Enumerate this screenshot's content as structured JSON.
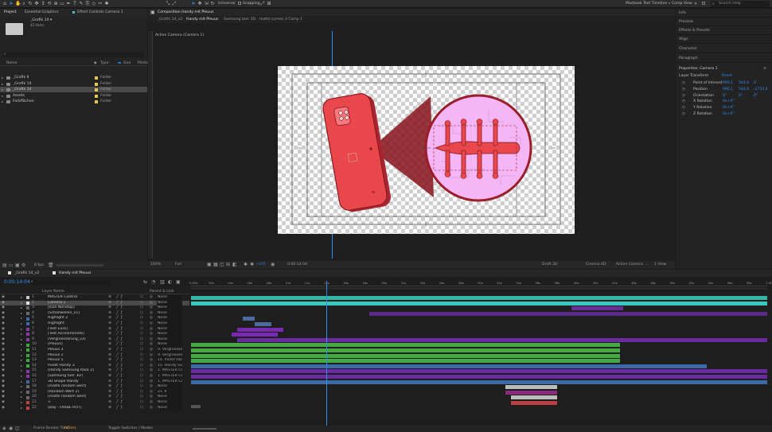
{
  "toolbar": {
    "universal_label": "Universal",
    "snapping_label": "Snapping",
    "workspace_label": "Macbook Text Timeline » Comp View",
    "search_placeholder": "Search Help"
  },
  "project": {
    "tab_project": "Project",
    "tab_graphics": "Essential Graphics",
    "tab_effect": "Effect Controls Camera 1",
    "selected_name": "_Grafik 14 ▾",
    "selected_items": "45 items",
    "col_name": "Name",
    "col_type": "Type",
    "col_size": "Size",
    "col_media": "Media",
    "rows": [
      {
        "name": "_Grafik 6",
        "type": "Folder",
        "color": "#e6c84a",
        "selected": false
      },
      {
        "name": "_Grafik 14",
        "type": "Folder",
        "color": "#e6c84a",
        "selected": false
      },
      {
        "name": "_Grafik 14",
        "type": "Folder",
        "color": "#e6c84a",
        "selected": true
      },
      {
        "name": "Assets",
        "type": "Folder",
        "color": "#e6c84a",
        "selected": false
      },
      {
        "name": "Farbflächen",
        "type": "Folder",
        "color": "#e6c84a",
        "selected": false
      }
    ],
    "bpc": "8 bpc"
  },
  "viewer": {
    "comp_title": "Composition Handy mit Pleuus",
    "tabs": [
      "_Grafik 14_v2",
      "Handy mit Pleuus",
      "Samsung tuer 3D",
      "matte screen 3 Comp 1"
    ],
    "active_camera": "Active Camera (Camera 1)",
    "zoom": "100%",
    "resolution": "Full",
    "exposure": "+0,0",
    "timecode": "0:00:14:04",
    "renderer": "Draft 3D",
    "engine": "Cinema 4D",
    "view": "Active Camera ...",
    "views": "1 View",
    "colors": {
      "phone": "#e8484c",
      "phone_dark": "#a92630",
      "circle": "#f0a8f0",
      "beam": "#8a1820"
    }
  },
  "right_panel": {
    "sections": [
      "Info",
      "Preview",
      "Effects & Presets",
      "Align",
      "Character",
      "Paragraph"
    ],
    "properties_title": "Properties: Camera 1",
    "layer_transform": "Layer Transform",
    "reset": "Reset",
    "props": [
      {
        "name": "Point of Interest",
        "v1": "990,1",
        "v2": "544,6",
        "v3": "0"
      },
      {
        "name": "Position",
        "v1": "990,1",
        "v2": "544,6",
        "v3": "-2733,4"
      },
      {
        "name": "Orientation",
        "v1": "0°",
        "v2": "0°",
        "v3": "0°"
      },
      {
        "name": "X Rotation",
        "v1": "0x+0°",
        "v2": "",
        "v3": ""
      },
      {
        "name": "Y Rotation",
        "v1": "0x+0°",
        "v2": "",
        "v3": ""
      },
      {
        "name": "Z Rotation",
        "v1": "0x+0°",
        "v2": "",
        "v3": ""
      }
    ]
  },
  "timeline": {
    "tab_a": "_Grafik 14_v2",
    "tab_b": "Handy mit Pleuus",
    "timecode": "0:00:14:04",
    "col_layer": "Layer Name",
    "col_parent": "Parent & Link",
    "ruler": [
      "0:00s",
      "02s",
      "04s",
      "06s",
      "08s",
      "10s",
      "12s",
      "14s",
      "16s",
      "18s",
      "20s",
      "22s",
      "24s",
      "26s",
      "28s",
      "30s",
      "32s",
      "34s",
      "36s",
      "38s",
      "40s",
      "42s",
      "44s",
      "46s",
      "48s",
      "50s",
      "52s",
      "54s",
      "56s",
      "58s",
      "1:00"
    ],
    "layers": [
      {
        "num": "1",
        "name": "MASTER Control",
        "parent": "None",
        "color": "#c8c8c8",
        "bar": {
          "start": 0.0,
          "end": 1.0,
          "color": "#33b5a5"
        }
      },
      {
        "num": "2",
        "name": "Camera 1",
        "parent": "None",
        "color": "#e0e0e0",
        "bar": {
          "start": 0.0,
          "end": 1.0,
          "color": "#39c7c0"
        }
      },
      {
        "num": "3",
        "name": "[Icon Nonstop]",
        "parent": "None",
        "color": "#6a6a6a",
        "bar": {
          "start": 0.66,
          "end": 0.75,
          "color": "#6a2a9a"
        }
      },
      {
        "num": "4",
        "name": "[Schallwellen_v1]",
        "parent": "None",
        "color": "#6a6a6a",
        "bar": {
          "start": 0.31,
          "end": 1.0,
          "color": "#5a2a8a"
        }
      },
      {
        "num": "5",
        "name": "Highlight 2",
        "parent": "None",
        "color": "#3a6aa8",
        "bar": {
          "start": 0.09,
          "end": 0.11,
          "color": "#4b6aa0"
        }
      },
      {
        "num": "6",
        "name": "Highlight",
        "parent": "None",
        "color": "#3a6aa8",
        "bar": {
          "start": 0.11,
          "end": 0.14,
          "color": "#4b6aa0"
        }
      },
      {
        "num": "7",
        "name": "[Text Euro]",
        "parent": "None",
        "color": "#8a3aa8",
        "bar": {
          "start": 0.08,
          "end": 0.16,
          "color": "#7a2ab0"
        }
      },
      {
        "num": "8",
        "name": "[Text Acceleromete]",
        "parent": "None",
        "color": "#8a3aa8",
        "bar": {
          "start": 0.07,
          "end": 0.15,
          "color": "#7a2ab0"
        }
      },
      {
        "num": "9",
        "name": "[Vergroesserung_v3]",
        "parent": "None",
        "color": "#8a3aa8",
        "bar": {
          "start": 0.08,
          "end": 1.0,
          "color": "#6a2aa0"
        }
      },
      {
        "num": "10",
        "name": "[Pleuus]",
        "parent": "None",
        "color": "#3aa83a",
        "bar": {
          "start": 0.0,
          "end": 0.745,
          "color": "#44aa44"
        }
      },
      {
        "num": "11",
        "name": "Pleuus 3",
        "parent": "9. Vergroesse",
        "color": "#3aa83a",
        "bar": {
          "start": 0.0,
          "end": 0.745,
          "color": "#44aa44"
        }
      },
      {
        "num": "12",
        "name": "Pleuus 2",
        "parent": "9. Vergroesse",
        "color": "#3aa83a",
        "bar": {
          "start": 0.0,
          "end": 0.745,
          "color": "#44aa44"
        }
      },
      {
        "num": "13",
        "name": "Pleuus 1",
        "parent": "14. Punkt Har",
        "color": "#3aa83a",
        "bar": {
          "start": 0.0,
          "end": 0.745,
          "color": "#44aa44"
        }
      },
      {
        "num": "14",
        "name": "Punkt Handy 3",
        "parent": "15. Handy Sa",
        "color": "#3aa83a",
        "bar": {
          "start": 0.0,
          "end": 0.895,
          "color": "#3a6aa8"
        }
      },
      {
        "num": "15",
        "name": "[Handy Samsung Rack 2]",
        "parent": "1. MASTER Cc",
        "color": "#8a3aa8",
        "bar": {
          "start": 0.0,
          "end": 1.0,
          "color": "#6a2aa0"
        }
      },
      {
        "num": "16",
        "name": "[Samsung tuer 3D]",
        "parent": "1. MASTER Cc",
        "color": "#8a3aa8",
        "bar": {
          "start": 0.0,
          "end": 1.0,
          "color": "#6a2aa0"
        }
      },
      {
        "num": "17",
        "name": "3D Shape Handy",
        "parent": "1. MASTER Cc",
        "color": "#3a6aa8",
        "bar": {
          "start": 0.0,
          "end": 1.0,
          "color": "#3a6aa8"
        }
      },
      {
        "num": "18",
        "name": "[matte random wert]",
        "parent": "None",
        "color": "#6a6a6a",
        "bar": {
          "start": 0.545,
          "end": 0.635,
          "color": "#bcbcbc"
        }
      },
      {
        "num": "19",
        "name": "[Random Wert 2]",
        "parent": "21. ▾",
        "color": "#6a6a6a",
        "bar": {
          "start": 0.545,
          "end": 0.635,
          "color": "#8a2a7a"
        }
      },
      {
        "num": "20",
        "name": "[matte random wert]",
        "parent": "None",
        "color": "#6a6a6a",
        "bar": {
          "start": 0.555,
          "end": 0.635,
          "color": "#bcbcbc"
        }
      },
      {
        "num": "21",
        "name": "∞",
        "parent": "None",
        "color": "#c84040",
        "bar": {
          "start": 0.555,
          "end": 0.635,
          "color": "#b84040"
        }
      },
      {
        "num": "22",
        "name": "[Bay - FARBE ROT]",
        "parent": "None",
        "color": "#c84040",
        "bar": {
          "start": 0.0,
          "end": 0.0,
          "color": "#c84040"
        }
      }
    ],
    "playhead_fraction": 0.235
  },
  "status": {
    "render_time_label": "Frame Render Time:",
    "render_time_value": "445ms",
    "toggle_label": "Toggle Switches / Modes"
  }
}
